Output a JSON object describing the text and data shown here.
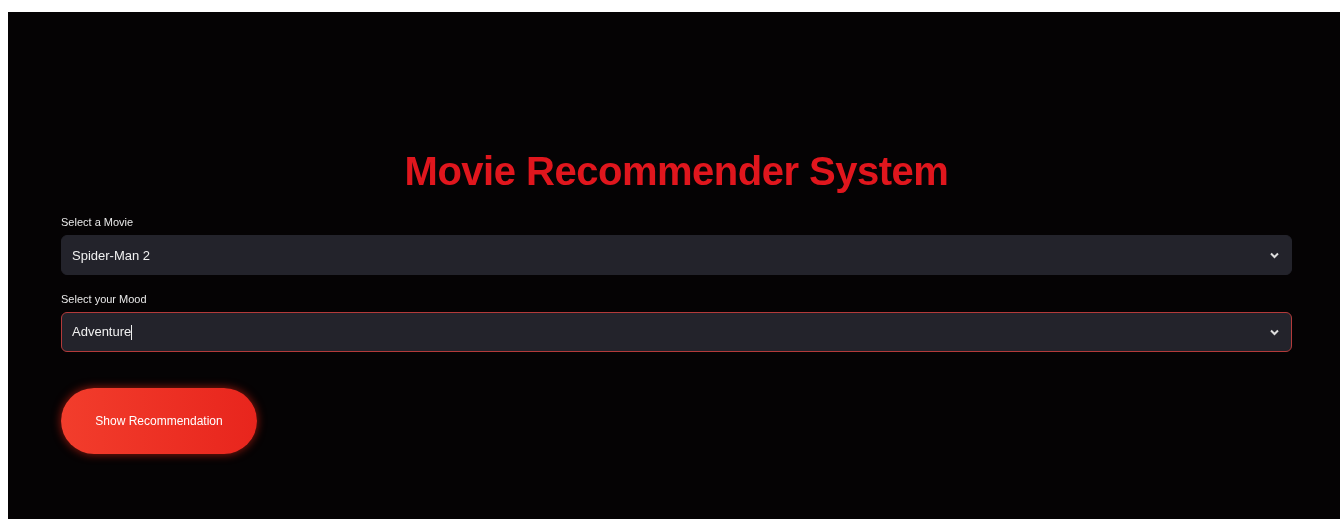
{
  "title": "Movie Recommender System",
  "selects": [
    {
      "label": "Select a Movie",
      "value": "Spider-Man 2",
      "focused": false
    },
    {
      "label": "Select your Mood",
      "value": "Adventure",
      "focused": true
    }
  ],
  "button": "Show Recommendation"
}
